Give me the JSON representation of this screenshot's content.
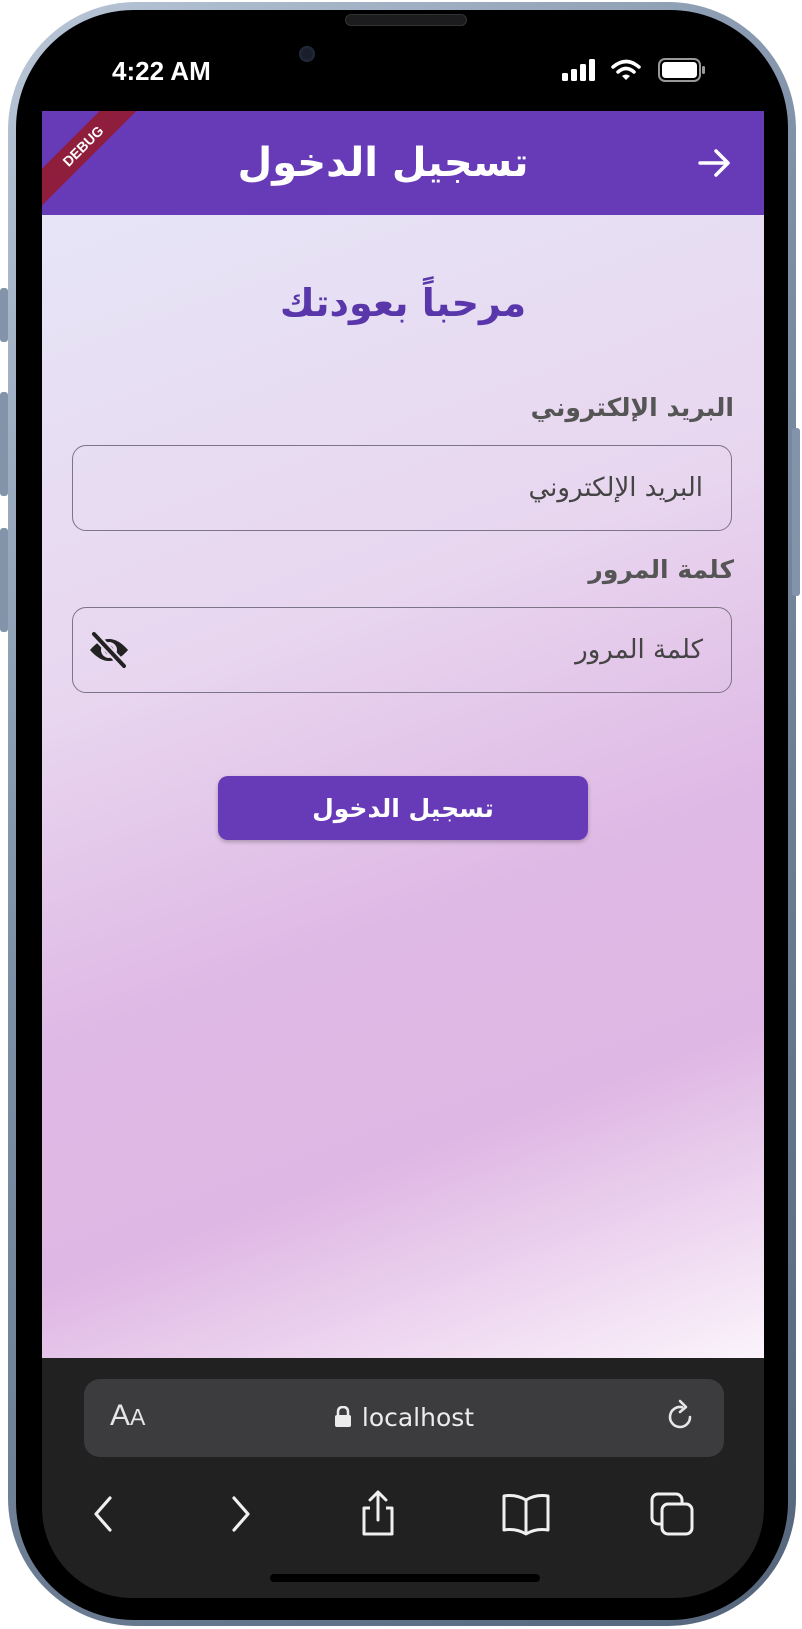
{
  "status_bar": {
    "time": "4:22 AM"
  },
  "app_bar": {
    "title": "تسجيل الدخول",
    "debug_banner": "DEBUG"
  },
  "login": {
    "heading": "مرحباً بعودتك",
    "email_label": "البريد الإلكتروني",
    "email_placeholder": "البريد الإلكتروني",
    "password_label": "كلمة المرور",
    "password_placeholder": "كلمة المرور",
    "submit_label": "تسجيل الدخول"
  },
  "browser": {
    "text_size_big": "A",
    "text_size_small": "A",
    "url": "localhost"
  },
  "colors": {
    "primary": "#673ab7",
    "heading": "#5a36ab",
    "debug_ribbon": "#8e1e3c",
    "browser_chrome": "#212121"
  },
  "icons": [
    "back-arrow-icon",
    "eye-off-icon",
    "lock-icon",
    "reload-icon",
    "chevron-left-icon",
    "chevron-right-icon",
    "share-icon",
    "bookmarks-icon",
    "tabs-icon",
    "cellular-signal-icon",
    "wifi-icon",
    "battery-icon"
  ]
}
